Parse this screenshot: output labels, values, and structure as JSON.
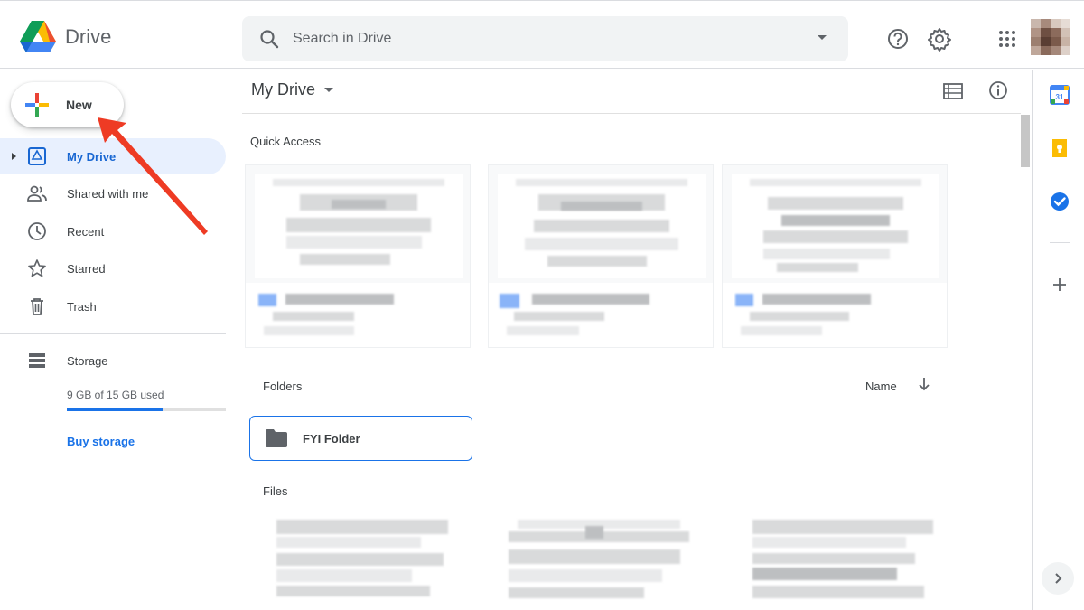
{
  "app": {
    "name": "Drive"
  },
  "search": {
    "placeholder": "Search in Drive"
  },
  "topbar_icons": [
    "help-icon",
    "settings-icon",
    "apps-grid-icon",
    "avatar"
  ],
  "new_button": {
    "label": "New"
  },
  "sidebar": {
    "items": [
      {
        "label": "My Drive",
        "icon": "my-drive-icon",
        "active": true
      },
      {
        "label": "Shared with me",
        "icon": "shared-people-icon",
        "active": false
      },
      {
        "label": "Recent",
        "icon": "clock-icon",
        "active": false
      },
      {
        "label": "Starred",
        "icon": "star-icon",
        "active": false
      },
      {
        "label": "Trash",
        "icon": "trash-icon",
        "active": false
      }
    ],
    "storage": {
      "label": "Storage",
      "used_text": "9 GB of 15 GB used",
      "used_fraction": 0.6,
      "buy_label": "Buy storage"
    }
  },
  "main": {
    "title": "My Drive",
    "quick_access_label": "Quick Access",
    "folders_label": "Folders",
    "sort_label": "Name",
    "folders": [
      {
        "name": "FYI Folder"
      }
    ],
    "files_label": "Files"
  },
  "right_panel": {
    "icons": [
      "calendar-icon",
      "keep-icon",
      "tasks-icon",
      "add-icon"
    ],
    "calendar_day": "31"
  },
  "colors": {
    "accent": "#1a73e8",
    "active_bg": "#e8f0fe",
    "annotation_arrow": "#ee3b24"
  }
}
